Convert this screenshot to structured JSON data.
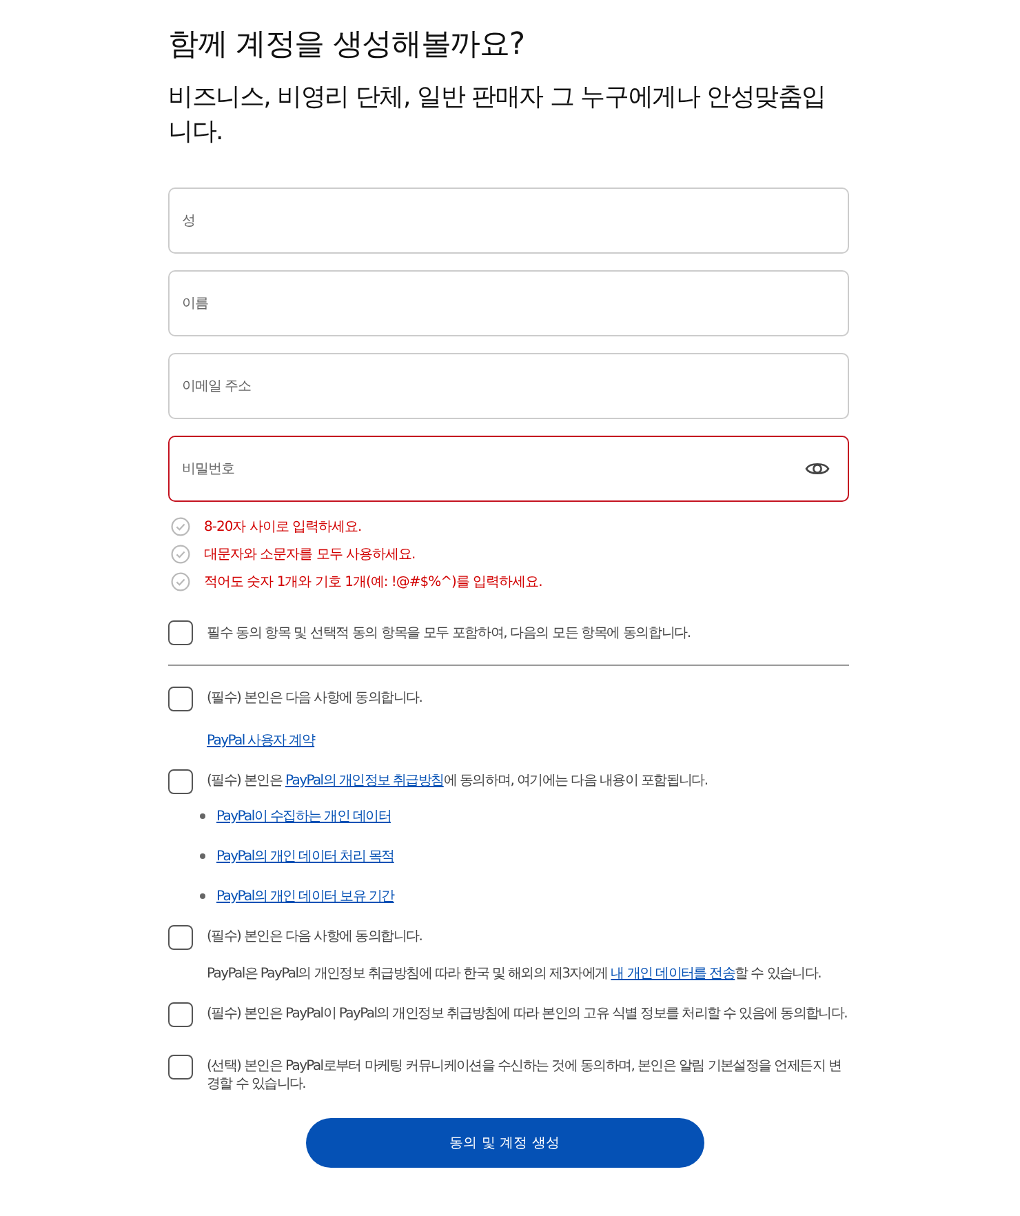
{
  "heading": "함께 계정을 생성해볼까요?",
  "subheading": "비즈니스, 비영리 단체, 일반 판매자 그 누구에게나 안성맞춤입니다.",
  "fields": [
    {
      "placeholder": "성",
      "invalid": false,
      "kind": "text"
    },
    {
      "placeholder": "이름",
      "invalid": false,
      "kind": "text"
    },
    {
      "placeholder": "이메일 주소",
      "invalid": false,
      "kind": "text"
    },
    {
      "placeholder": "비밀번호",
      "invalid": true,
      "kind": "password"
    }
  ],
  "password_rules": [
    {
      "text": "8-20자 사이로 입력하세요.",
      "met": false
    },
    {
      "text": "대문자와 소문자를 모두 사용하세요.",
      "met": false
    },
    {
      "text": "적어도 숫자 1개와 기호 1개(예: !@#$%^)를 입력하세요.",
      "met": false
    }
  ],
  "agree_all": {
    "checked": false,
    "text": "필수 동의 항목 및 선택적 동의 항목을 모두 포함하여, 다음의 모든 항목에 동의합니다."
  },
  "consents": [
    {
      "checked": false,
      "lines": [
        {
          "kind": "main",
          "parts": [
            {
              "text": "(필수) 본인은 다음 사항에 동의합니다.",
              "kind": "text"
            }
          ]
        },
        {
          "kind": "note",
          "parts": [
            {
              "text": "PayPal 사용자 계약",
              "kind": "link"
            }
          ]
        }
      ]
    },
    {
      "checked": false,
      "lines": [
        {
          "kind": "main",
          "parts": [
            {
              "text": "(필수) 본인은 ",
              "kind": "text"
            },
            {
              "text": "PayPal의 개인정보 취급방침",
              "kind": "link"
            },
            {
              "text": "에 동의하며, 여기에는 다음 내용이 포함됩니다.",
              "kind": "text"
            }
          ]
        },
        {
          "kind": "bullet",
          "parts": [
            {
              "text": "PayPal이 수집하는 개인 데이터",
              "kind": "link"
            }
          ]
        },
        {
          "kind": "bullet",
          "parts": [
            {
              "text": "PayPal의 개인 데이터 처리 목적",
              "kind": "link"
            }
          ]
        },
        {
          "kind": "bullet",
          "parts": [
            {
              "text": "PayPal의 개인 데이터 보유 기간",
              "kind": "link"
            }
          ]
        }
      ]
    },
    {
      "checked": false,
      "lines": [
        {
          "kind": "main",
          "parts": [
            {
              "text": "(필수) 본인은 다음 사항에 동의합니다.",
              "kind": "text"
            }
          ]
        },
        {
          "kind": "note",
          "parts": [
            {
              "text": "PayPal은 PayPal의 개인정보 취급방침에 따라 한국 및 해외의 제3자에게 ",
              "kind": "text"
            },
            {
              "text": "내 개인 데이터를 전송",
              "kind": "link"
            },
            {
              "text": "할 수 있습니다.",
              "kind": "text"
            }
          ]
        }
      ]
    },
    {
      "checked": false,
      "lines": [
        {
          "kind": "main",
          "parts": [
            {
              "text": "(필수) 본인은 PayPal이 PayPal의 개인정보 취급방침에 따라 본인의 고유 식별 정보를 처리할 수 있음에 동의합니다.",
              "kind": "text"
            }
          ]
        }
      ]
    },
    {
      "checked": false,
      "lines": [
        {
          "kind": "main",
          "parts": [
            {
              "text": "(선택) 본인은 PayPal로부터 마케팅 커뮤니케이션을 수신하는 것에 동의하며, 본인은 알림 기본설정을 언제든지 변경할 수 있습니다.",
              "kind": "text"
            }
          ]
        }
      ]
    }
  ],
  "submit_button": "동의 및 계정 생성"
}
